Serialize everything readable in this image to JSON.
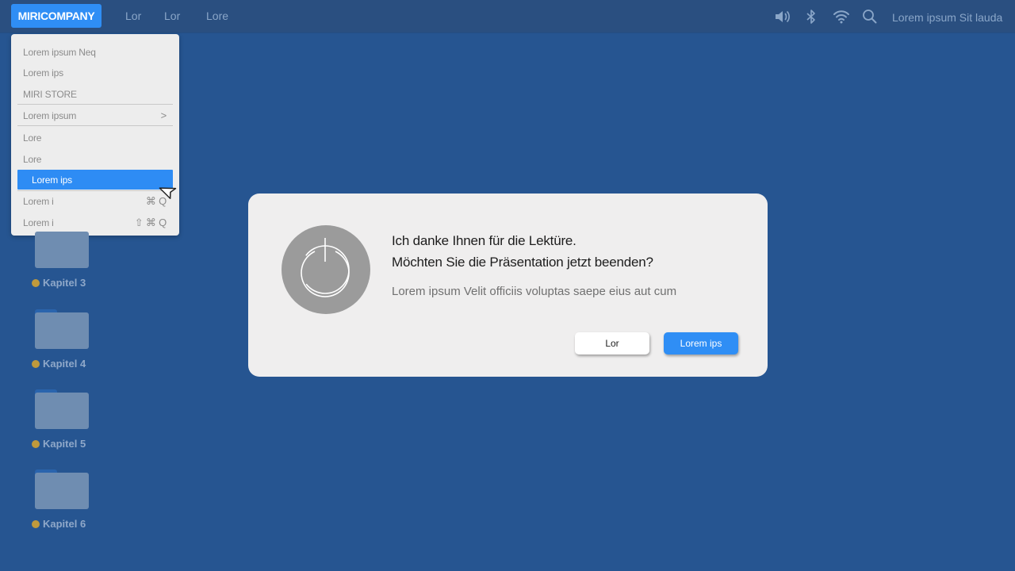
{
  "menubar": {
    "brand": "MIRICOMPANY",
    "links": [
      "Lor",
      "Lor",
      "Lore"
    ],
    "clock": "Lorem ipsum Sit lauda",
    "status_icons": [
      "speaker-icon",
      "bluetooth-icon",
      "wifi-icon",
      "search-icon"
    ]
  },
  "dropdown": {
    "items": [
      {
        "label": "Lorem ipsum Neq"
      },
      {
        "label": "Lorem ips"
      },
      {
        "label": "MIRI STORE"
      },
      {
        "label": "Lorem ipsum",
        "suffix": ">"
      },
      {
        "label": "Lore"
      },
      {
        "label": "Lore"
      },
      {
        "label": "Lorem ips",
        "selected": true
      },
      {
        "label": "Lorem i",
        "shortcut": "⌘ Q"
      },
      {
        "label": "Lorem i",
        "shortcut": "⇧ ⌘ Q"
      }
    ]
  },
  "desktop": {
    "folders": [
      {
        "label": "Kapitel 3"
      },
      {
        "label": "Kapitel 4"
      },
      {
        "label": "Kapitel 5"
      },
      {
        "label": "Kapitel 6"
      }
    ]
  },
  "dialog": {
    "title_line1": "Ich danke Ihnen für die Lektüre.",
    "title_line2": "Möchten Sie die Präsentation jetzt beenden?",
    "body": "Lorem ipsum Velit officiis voluptas saepe eius aut cum",
    "cancel_label": "Lor",
    "confirm_label": "Lorem ips"
  },
  "colors": {
    "desktop": "#265591",
    "menubar": "#2a4f80",
    "accent": "#2f8ef5",
    "dialog": "#efeeee",
    "folder_dot": "#c09a3c"
  }
}
